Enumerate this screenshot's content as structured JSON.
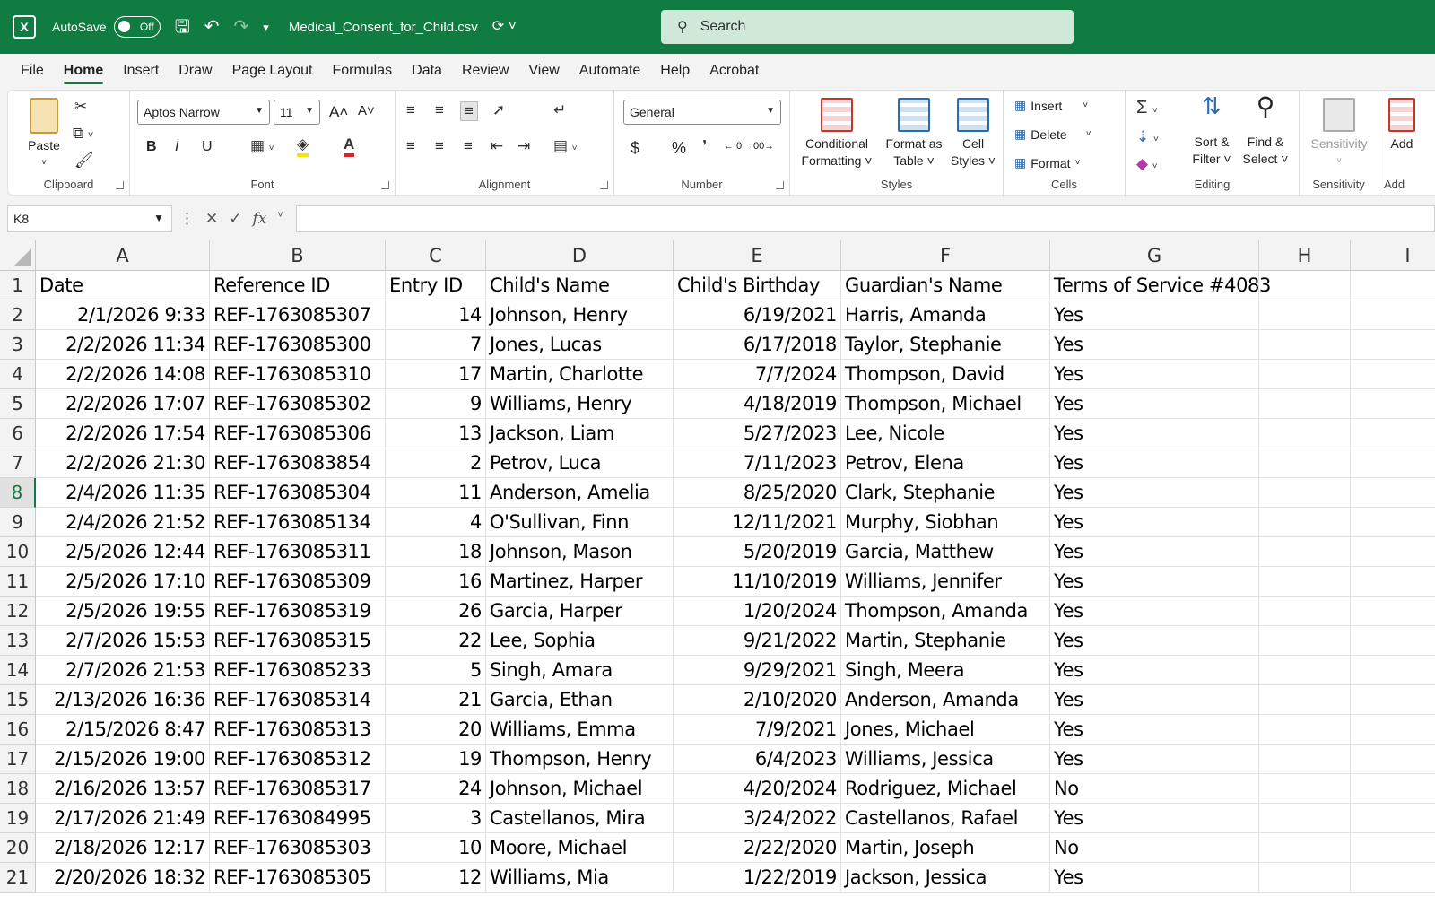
{
  "titlebar": {
    "autosave_label": "AutoSave",
    "autosave_state": "Off",
    "filename": "Medical_Consent_for_Child.csv",
    "search_placeholder": "Search"
  },
  "menu": [
    "File",
    "Home",
    "Insert",
    "Draw",
    "Page Layout",
    "Formulas",
    "Data",
    "Review",
    "View",
    "Automate",
    "Help",
    "Acrobat"
  ],
  "menu_active": "Home",
  "ribbon": {
    "clipboard": {
      "label": "Clipboard",
      "paste": "Paste"
    },
    "font": {
      "label": "Font",
      "name": "Aptos Narrow",
      "size": "11",
      "bold": "B",
      "italic": "I",
      "underline": "U",
      "grow": "A˄",
      "shrink": "A˅"
    },
    "alignment": {
      "label": "Alignment"
    },
    "number": {
      "label": "Number",
      "format": "General",
      "currency": "$",
      "percent": "%",
      "comma": "͗",
      "inc": "←.0 .00",
      "dec": ".00 →.0"
    },
    "styles": {
      "label": "Styles",
      "conditional": "Conditional\nFormatting",
      "conditional_l1": "Conditional",
      "conditional_l2": "Formatting ˅",
      "format_table_l1": "Format as",
      "format_table_l2": "Table ˅",
      "cell_styles_l1": "Cell",
      "cell_styles_l2": "Styles ˅"
    },
    "cells": {
      "label": "Cells",
      "insert": "Insert",
      "delete": "Delete",
      "format": "Format"
    },
    "editing": {
      "label": "Editing",
      "sort_l1": "Sort &",
      "sort_l2": "Filter ˅",
      "find_l1": "Find &",
      "find_l2": "Select ˅"
    },
    "sensitivity": {
      "label": "Sensitivity",
      "button": "Sensitivity"
    },
    "addins": {
      "label": "Add",
      "button": "Add"
    }
  },
  "formula_bar": {
    "name_box": "K8",
    "fx": "fx",
    "content": ""
  },
  "columns": [
    "A",
    "B",
    "C",
    "D",
    "E",
    "F",
    "G",
    "H",
    "I"
  ],
  "header_row": [
    "Date",
    "Reference ID",
    "Entry ID",
    "Child's Name",
    "Child's Birthday",
    "Guardian's Name",
    "Terms of Service #4083"
  ],
  "rows": [
    [
      "2/1/2026 9:33",
      "REF-1763085307",
      "14",
      "Johnson, Henry",
      "6/19/2021",
      "Harris, Amanda",
      "Yes"
    ],
    [
      "2/2/2026 11:34",
      "REF-1763085300",
      "7",
      "Jones, Lucas",
      "6/17/2018",
      "Taylor, Stephanie",
      "Yes"
    ],
    [
      "2/2/2026 14:08",
      "REF-1763085310",
      "17",
      "Martin, Charlotte",
      "7/7/2024",
      "Thompson, David",
      "Yes"
    ],
    [
      "2/2/2026 17:07",
      "REF-1763085302",
      "9",
      "Williams, Henry",
      "4/18/2019",
      "Thompson, Michael",
      "Yes"
    ],
    [
      "2/2/2026 17:54",
      "REF-1763085306",
      "13",
      "Jackson, Liam",
      "5/27/2023",
      "Lee, Nicole",
      "Yes"
    ],
    [
      "2/2/2026 21:30",
      "REF-1763083854",
      "2",
      "Petrov, Luca",
      "7/11/2023",
      "Petrov, Elena",
      "Yes"
    ],
    [
      "2/4/2026 11:35",
      "REF-1763085304",
      "11",
      "Anderson, Amelia",
      "8/25/2020",
      "Clark, Stephanie",
      "Yes"
    ],
    [
      "2/4/2026 21:52",
      "REF-1763085134",
      "4",
      "O'Sullivan, Finn",
      "12/11/2021",
      "Murphy, Siobhan",
      "Yes"
    ],
    [
      "2/5/2026 12:44",
      "REF-1763085311",
      "18",
      "Johnson, Mason",
      "5/20/2019",
      "Garcia, Matthew",
      "Yes"
    ],
    [
      "2/5/2026 17:10",
      "REF-1763085309",
      "16",
      "Martinez, Harper",
      "11/10/2019",
      "Williams, Jennifer",
      "Yes"
    ],
    [
      "2/5/2026 19:55",
      "REF-1763085319",
      "26",
      "Garcia, Harper",
      "1/20/2024",
      "Thompson, Amanda",
      "Yes"
    ],
    [
      "2/7/2026 15:53",
      "REF-1763085315",
      "22",
      "Lee, Sophia",
      "9/21/2022",
      "Martin, Stephanie",
      "Yes"
    ],
    [
      "2/7/2026 21:53",
      "REF-1763085233",
      "5",
      "Singh, Amara",
      "9/29/2021",
      "Singh, Meera",
      "Yes"
    ],
    [
      "2/13/2026 16:36",
      "REF-1763085314",
      "21",
      "Garcia, Ethan",
      "2/10/2020",
      "Anderson, Amanda",
      "Yes"
    ],
    [
      "2/15/2026 8:47",
      "REF-1763085313",
      "20",
      "Williams, Emma",
      "7/9/2021",
      "Jones, Michael",
      "Yes"
    ],
    [
      "2/15/2026 19:00",
      "REF-1763085312",
      "19",
      "Thompson, Henry",
      "6/4/2023",
      "Williams, Jessica",
      "Yes"
    ],
    [
      "2/16/2026 13:57",
      "REF-1763085317",
      "24",
      "Johnson, Michael",
      "4/20/2024",
      "Rodriguez, Michael",
      "No"
    ],
    [
      "2/17/2026 21:49",
      "REF-1763084995",
      "3",
      "Castellanos, Mira",
      "3/24/2022",
      "Castellanos, Rafael",
      "Yes"
    ],
    [
      "2/18/2026 12:17",
      "REF-1763085303",
      "10",
      "Moore, Michael",
      "2/22/2020",
      "Martin, Joseph",
      "No"
    ],
    [
      "2/20/2026 18:32",
      "REF-1763085305",
      "12",
      "Williams, Mia",
      "1/22/2019",
      "Jackson, Jessica",
      "Yes"
    ]
  ],
  "selected_cell": "K8",
  "selected_row": 8,
  "colors": {
    "accent": "#107c41",
    "search_bg": "#cfe8d8"
  }
}
